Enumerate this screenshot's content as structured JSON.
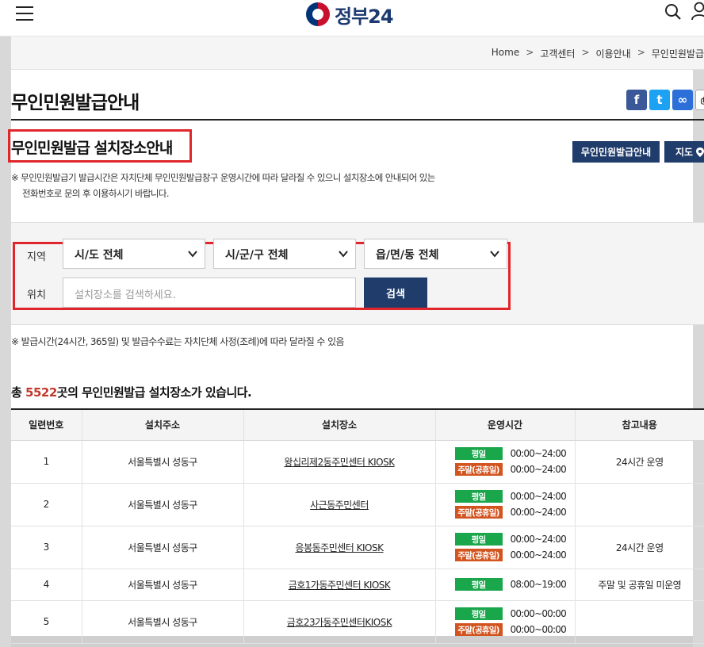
{
  "header": {
    "logo_text": "정부24",
    "icons": [
      "hamburger-menu-icon",
      "search-icon",
      "user-icon"
    ],
    "colors": {
      "navy": "#1f3c6b",
      "red_highlight": "#e0262b",
      "weekday_green": "#1aa64b",
      "weekend_orange": "#d2541f",
      "count_red": "#c0392b"
    }
  },
  "breadcrumb": {
    "items": [
      "Home",
      "고객센터",
      "이용안내",
      "무인민원발급"
    ],
    "separator": ">"
  },
  "page": {
    "title": "무인민원발급안내",
    "share_icons": [
      "facebook-icon",
      "twitter-icon",
      "link-icon",
      "print-icon"
    ],
    "share_glyphs": [
      "f",
      "t",
      "∞",
      "⎙"
    ],
    "subtitle": "무인민원발급 설치장소안내",
    "btn_info": "무인민원발급안내",
    "btn_map": "지도",
    "note_line1": "※ 무인민원발급기 발급시간은 자치단체 무인민원발급창구 운영시간에 따라 달라질 수 있으니 설치장소에 안내되어 있는",
    "note_line2": "전화번호로 문의 후 이용하시기 바랍니다."
  },
  "filter": {
    "region_label": "지역",
    "location_label": "위치",
    "sido": "시/도 전체",
    "sigungu": "시/군/구 전체",
    "eupmyeondong": "읍/면/동 전체",
    "search_placeholder": "설치장소를 검색하세요.",
    "search_button": "검색"
  },
  "note2": "※ 발급시간(24시간, 365일) 및 발급수수료는 자치단체 사정(조례)에 따라 달라질 수 있음",
  "summary": {
    "prefix": "총 ",
    "count": "5522",
    "suffix": "곳의 무인민원발급 설치장소가 있습니다."
  },
  "table": {
    "headers": [
      "일련번호",
      "설치주소",
      "설치장소",
      "운영시간",
      "참고내용"
    ],
    "weekday_label": "평일",
    "weekend_label": "주말(공휴일)",
    "rows": [
      {
        "no": "1",
        "address": "서울특별시 성동구",
        "place": "왕십리제2동주민센터 KIOSK",
        "weekday": "00:00~24:00",
        "weekend": "00:00~24:00",
        "note": "24시간 운영"
      },
      {
        "no": "2",
        "address": "서울특별시 성동구",
        "place": "사근동주민센터",
        "weekday": "00:00~24:00",
        "weekend": "00:00~24:00",
        "note": ""
      },
      {
        "no": "3",
        "address": "서울특별시 성동구",
        "place": "응봉동주민센터 KIOSK",
        "weekday": "00:00~24:00",
        "weekend": "00:00~24:00",
        "note": "24시간 운영"
      },
      {
        "no": "4",
        "address": "서울특별시 성동구",
        "place": "금호1가동주민센터 KIOSK",
        "weekday": "08:00~19:00",
        "weekend": "",
        "note": "주말 및 공휴일 미운영"
      },
      {
        "no": "5",
        "address": "서울특별시 성동구",
        "place": "금호23가동주민센터KIOSK",
        "weekday": "00:00~00:00",
        "weekend": "00:00~00:00",
        "note": ""
      }
    ]
  }
}
